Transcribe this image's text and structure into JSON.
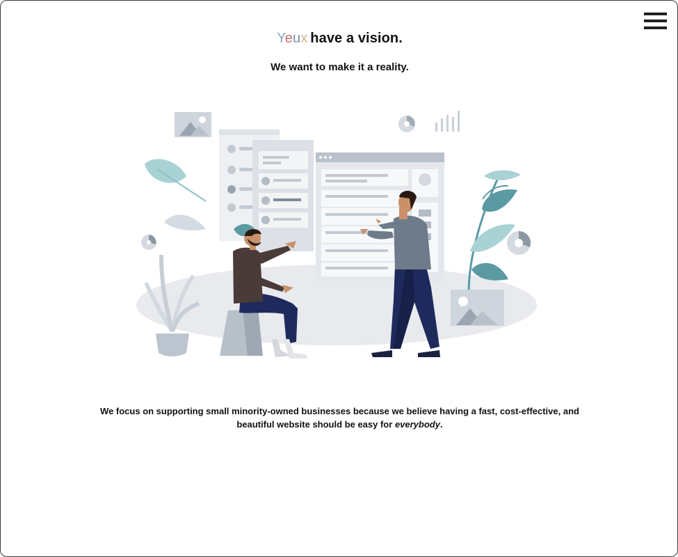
{
  "header": {
    "menu_icon": "hamburger-menu-icon"
  },
  "hero": {
    "brand_letters": [
      "Y",
      "e",
      "u",
      "x"
    ],
    "headline": "have a vision.",
    "subheadline": "We want to make it a reality."
  },
  "illustration": {
    "icon": "team-collaboration-illustration",
    "colors": {
      "teal": "#5b9aa3",
      "light_teal": "#a9d2d5",
      "panel_gray": "#e4e7ec",
      "shirt_gray": "#6d7b8a",
      "jacket_brown": "#4a3a38",
      "pants_navy": "#1f2a5c"
    }
  },
  "mission": {
    "text_before": "We focus on supporting small minority-owned businesses because we believe having a fast, cost-effective, and beautiful website should be easy for",
    "emphasis": "everybody",
    "text_after": "."
  }
}
